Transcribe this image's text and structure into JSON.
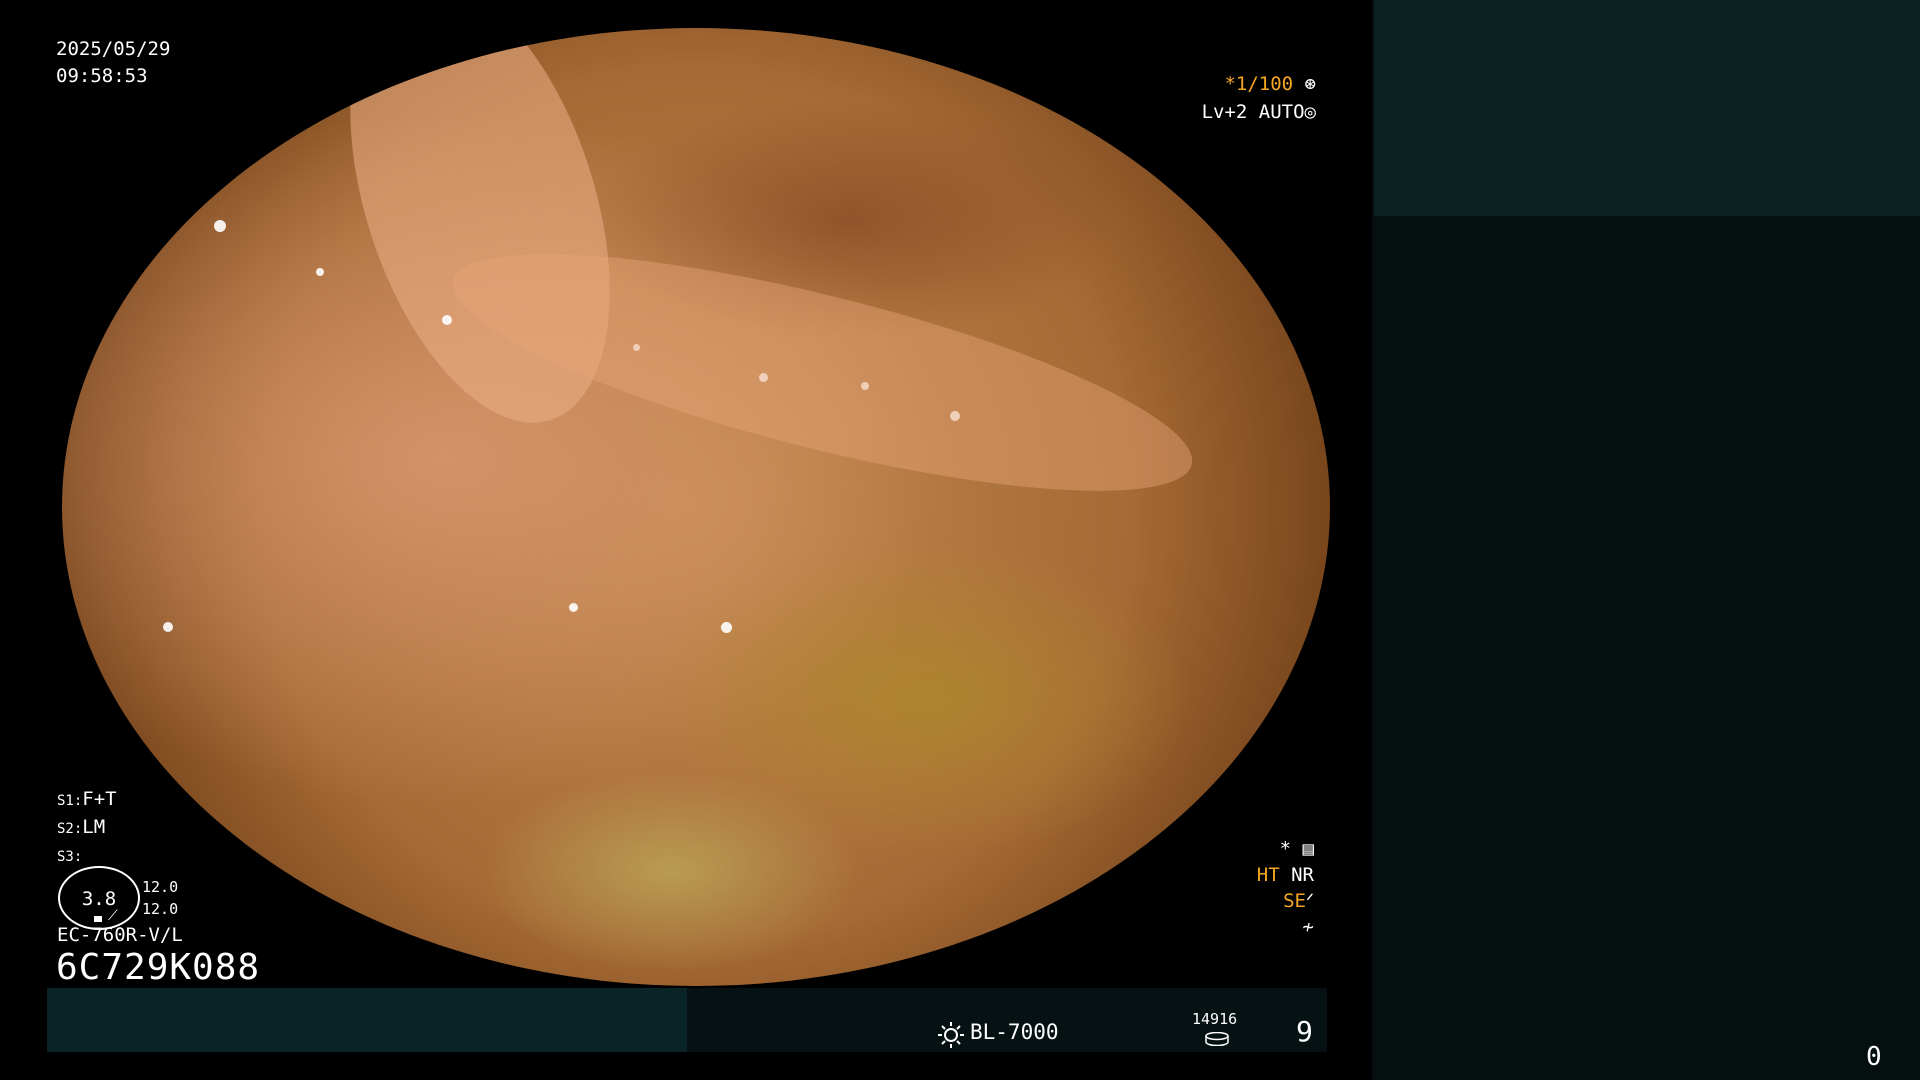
{
  "overlay": {
    "date": "2025/05/29",
    "time": "09:58:53",
    "shutter_prefix": "*",
    "shutter": "1/100",
    "level": "Lv+2",
    "mode": "AUTO",
    "s1_key": "S1:",
    "s1_val": "F+T",
    "s2_key": "S2:",
    "s2_val": "LM",
    "s3_key": "S3:",
    "s3_val": "",
    "dial_value": "3.8",
    "dial_num1": "12.0",
    "dial_num2": "12.0",
    "scope_model": "EC-760R-V/L",
    "serial": "6C729K088",
    "star": "*",
    "ht": "HT",
    "nr": "NR",
    "se": "SE"
  },
  "bottom": {
    "light_source": "BL-7000",
    "count": "14916",
    "page": "9"
  },
  "right_panel": {
    "number": "0"
  },
  "colors": {
    "accent_orange": "#f5a623",
    "teal_dark": "#082426",
    "panel_bg": "#060f0f"
  },
  "icons": [
    "shutter-icon",
    "auto-icon",
    "settings-icon",
    "curve-icon",
    "signal-icon",
    "sun-icon",
    "disk-icon"
  ]
}
